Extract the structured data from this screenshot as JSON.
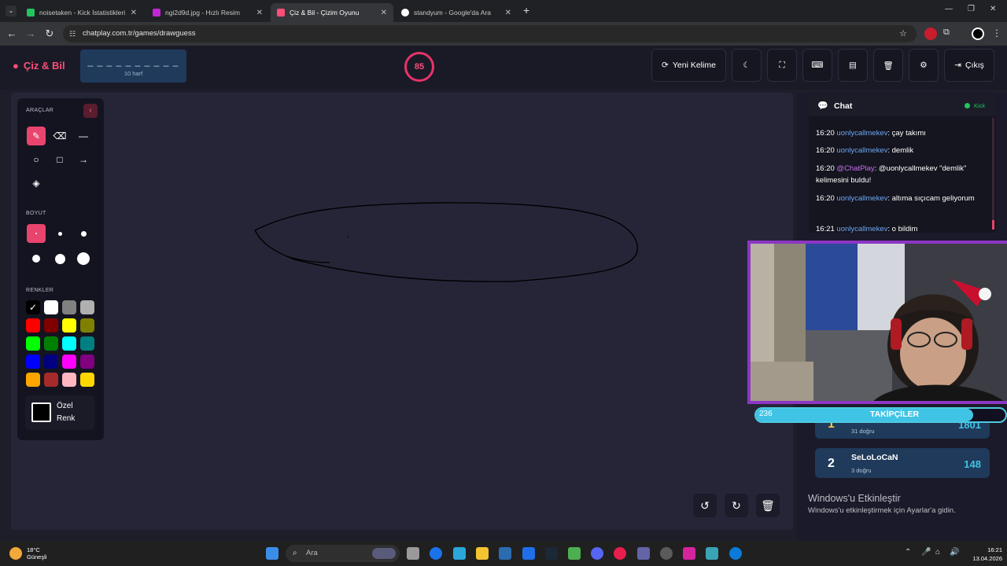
{
  "browser": {
    "tabs": [
      {
        "title": "noisetaken - Kick İstatistikleri",
        "active": false,
        "color": "#22c55e"
      },
      {
        "title": "ngi2d9d.jpg - Hızlı Resim",
        "active": false,
        "color": "#c026d3"
      },
      {
        "title": "Çiz & Bil - Çizim Oyunu",
        "active": true,
        "color": "#ff4d7a"
      },
      {
        "title": "standyum - Google'da Ara",
        "active": false,
        "color": "#4285f4"
      }
    ],
    "url": "chatplay.com.tr/games/drawguess"
  },
  "header": {
    "logo": "Çiz & Bil",
    "word_dashes": "_ _ _ _ _ _ _ _ _ _",
    "word_length": "10 harf",
    "timer": "85",
    "new_word_label": "Yeni Kelime",
    "logout_label": "Çıkış"
  },
  "tools": {
    "title": "ARAÇLAR",
    "size_title": "BOYUT",
    "colors_title": "RENKLER",
    "custom_color": [
      "Özel",
      "Renk"
    ],
    "palette": [
      "#000000",
      "#ffffff",
      "#808080",
      "#b0b0b0",
      "#ff0000",
      "#800000",
      "#ffff00",
      "#808000",
      "#00ff00",
      "#008000",
      "#00ffff",
      "#008080",
      "#0000ff",
      "#000080",
      "#ff00ff",
      "#800080",
      "#ffa500",
      "#a52a2a",
      "#ffb6c1",
      "#ffd700"
    ],
    "selected_color": "#000000",
    "selected_tool": "brush"
  },
  "chat": {
    "title": "Chat",
    "source": "Kick",
    "messages": [
      {
        "time": "16:20",
        "user": "uonlycallmekev",
        "text": ": çay takımı"
      },
      {
        "time": "16:20",
        "user": "uonlycallmekev",
        "text": ": demlik"
      },
      {
        "time": "16:20",
        "user": "@ChatPlay",
        "text": ": @uonlycallmekev \"demlik\" kelimesini buldu!"
      },
      {
        "time": "16:20",
        "user": "uonlycallmekev",
        "text": ": altıma sıçıcam geliyorum"
      },
      {
        "time": "16:21",
        "user": "uonlycallmekev",
        "text": ": o bildim"
      }
    ]
  },
  "followers": {
    "count": "236",
    "label": "TAKİPÇİLER",
    "progress": 0.87
  },
  "leaderboard": [
    {
      "rank": "1",
      "name": "",
      "sub": "31 doğru",
      "points": "1801"
    },
    {
      "rank": "2",
      "name": "SeLoLoCaN",
      "sub": "3 doğru",
      "points": "148"
    }
  ],
  "activation": {
    "title": "Windows'u Etkinleştir",
    "subtitle": "Windows'u etkinleştirmek için Ayarlar'a gidin."
  },
  "taskbar": {
    "temperature": "18°C",
    "weather": "Güneşli",
    "search_placeholder": "Ara",
    "time": "16:21",
    "date": "13.04.2026"
  }
}
